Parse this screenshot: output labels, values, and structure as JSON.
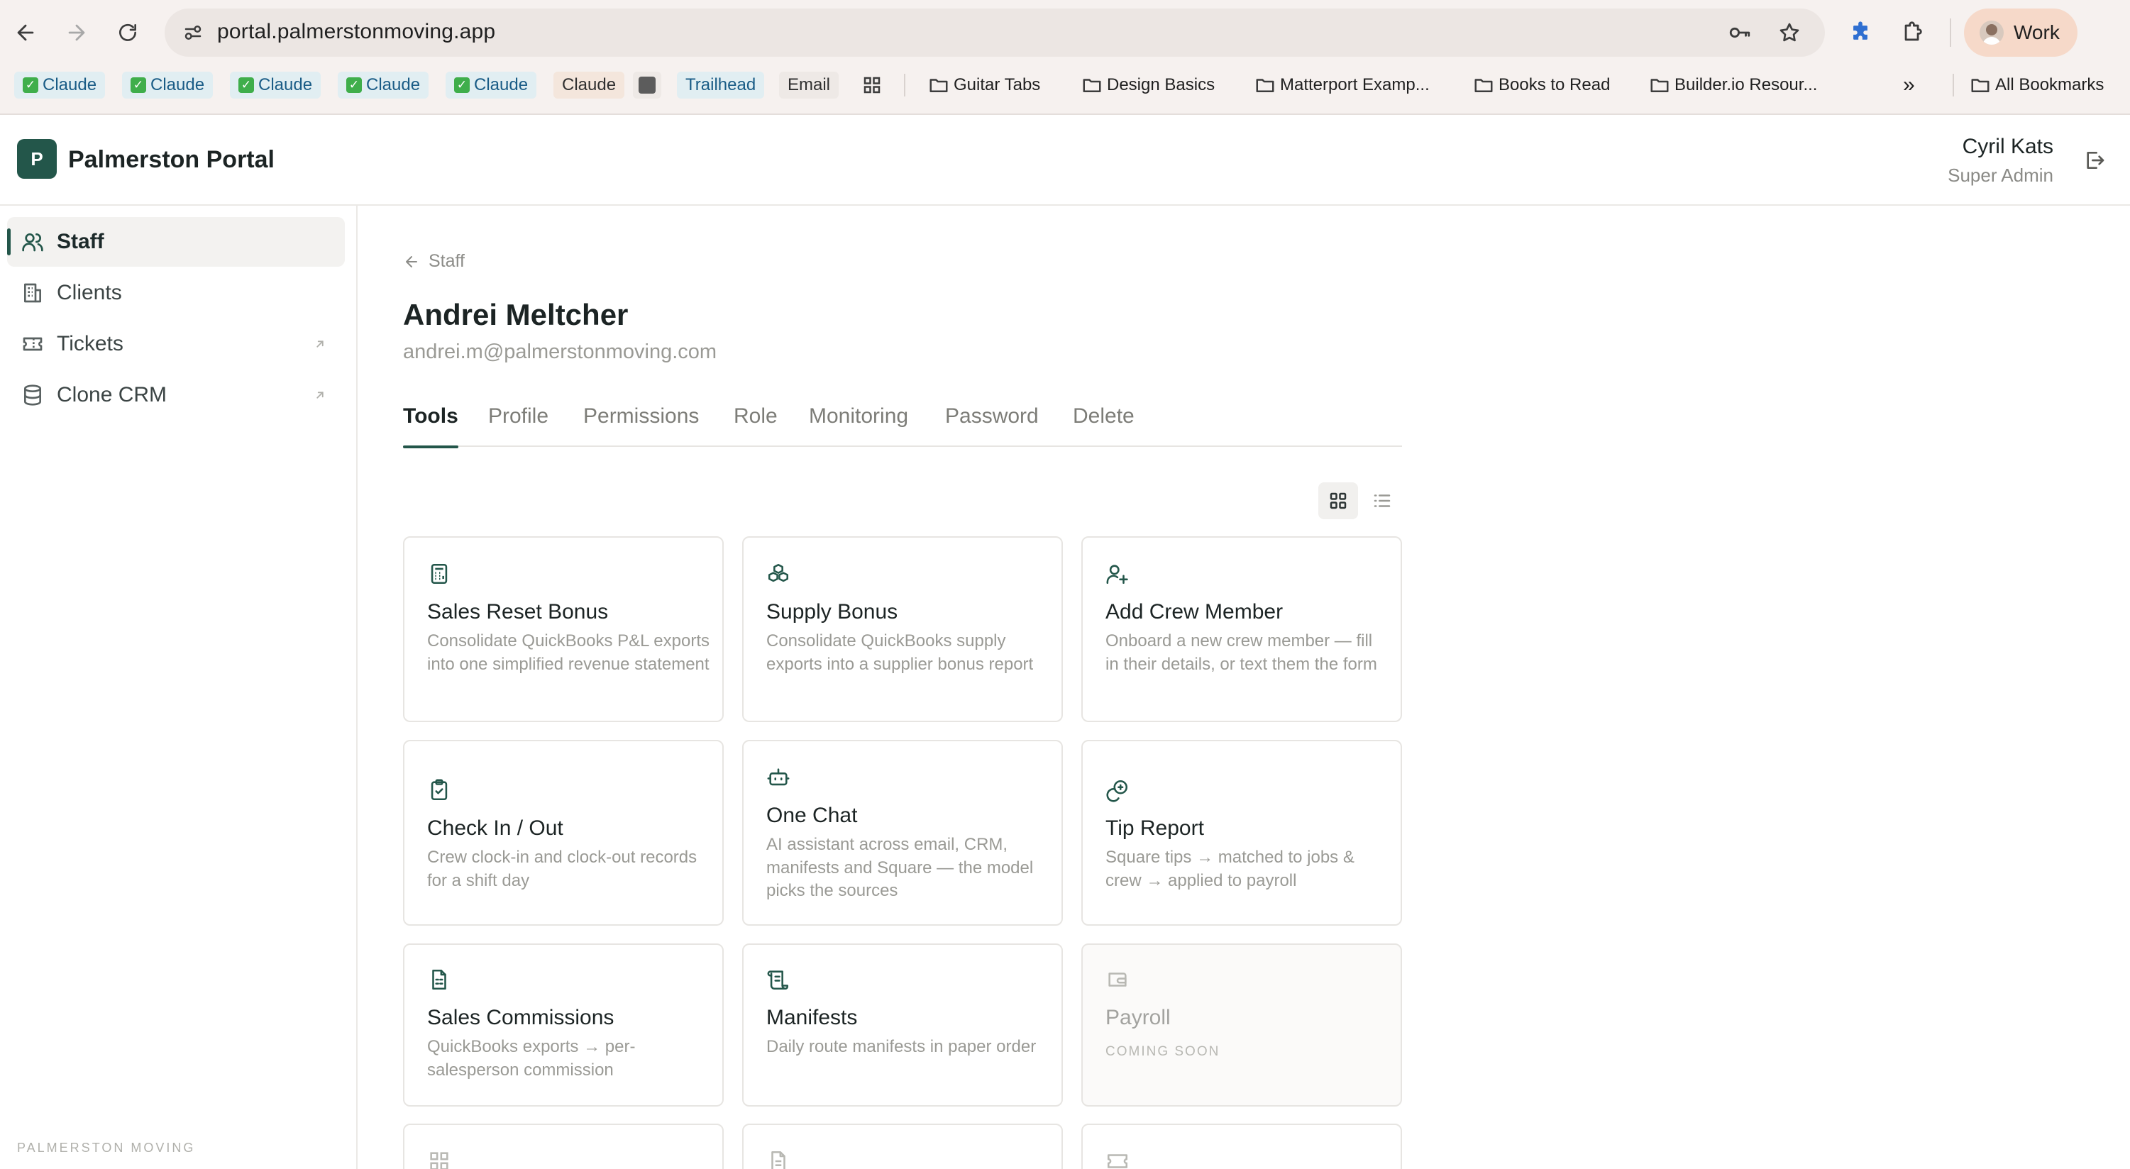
{
  "browser": {
    "url": "portal.palmerstonmoving.app",
    "profile_label": "Work",
    "bookmarks": [
      {
        "label": "Claude",
        "style": "check"
      },
      {
        "label": "Claude",
        "style": "check"
      },
      {
        "label": "Claude",
        "style": "check"
      },
      {
        "label": "Claude",
        "style": "check"
      },
      {
        "label": "Claude",
        "style": "check"
      },
      {
        "label": "Claude",
        "style": "plain"
      },
      {
        "label": "",
        "style": "square"
      },
      {
        "label": "Trailhead",
        "style": "chip"
      },
      {
        "label": "Email",
        "style": "plain"
      },
      {
        "label": "",
        "style": "apps"
      },
      {
        "label": "Guitar Tabs",
        "style": "folder"
      },
      {
        "label": "Design Basics",
        "style": "folder"
      },
      {
        "label": "Matterport Examp...",
        "style": "folder"
      },
      {
        "label": "Books to Read",
        "style": "folder"
      },
      {
        "label": "Builder.io Resour...",
        "style": "folder"
      }
    ],
    "overflow_label": "»",
    "all_bookmarks_label": "All Bookmarks"
  },
  "app": {
    "logo_letter": "P",
    "brand": "Palmerston Portal",
    "user_name": "Cyril Kats",
    "user_role": "Super Admin",
    "accent_color": "#23564a"
  },
  "sidebar": {
    "items": [
      {
        "label": "Staff",
        "icon": "users-icon",
        "active": true,
        "external": false
      },
      {
        "label": "Clients",
        "icon": "building-icon",
        "active": false,
        "external": false
      },
      {
        "label": "Tickets",
        "icon": "ticket-icon",
        "active": false,
        "external": true
      },
      {
        "label": "Clone CRM",
        "icon": "database-icon",
        "active": false,
        "external": true
      }
    ],
    "footer": "PALMERSTON MOVING"
  },
  "page": {
    "back_label": "Staff",
    "name": "Andrei Meltcher",
    "email": "andrei.m@palmerstonmoving.com",
    "tabs": [
      "Tools",
      "Profile",
      "Permissions",
      "Role",
      "Monitoring",
      "Password",
      "Delete"
    ],
    "active_tab": "Tools",
    "view_mode": "grid"
  },
  "tools": [
    {
      "title": "Sales Reset Bonus",
      "desc": "Consolidate QuickBooks P&L exports into one simplified revenue statement",
      "icon": "calculator-icon"
    },
    {
      "title": "Supply Bonus",
      "desc": "Consolidate QuickBooks supply exports into a supplier bonus report",
      "icon": "boxes-icon"
    },
    {
      "title": "Add Crew Member",
      "desc": "Onboard a new crew member — fill in their details, or text them the form",
      "icon": "user-plus-icon"
    },
    {
      "title": "Check In / Out",
      "desc": "Crew clock-in and clock-out records for a shift day",
      "icon": "clipboard-check-icon"
    },
    {
      "title": "One Chat",
      "desc": "AI assistant across email, CRM, manifests and Square — the model picks the sources",
      "icon": "bot-icon"
    },
    {
      "title": "Tip Report",
      "desc": "Square tips → matched to jobs & crew → applied to payroll",
      "icon": "coins-icon"
    },
    {
      "title": "Sales Commissions",
      "desc": "QuickBooks exports → per-salesperson commission",
      "icon": "file-spreadsheet-icon"
    },
    {
      "title": "Manifests",
      "desc": "Daily route manifests in paper order",
      "icon": "scroll-icon"
    },
    {
      "title": "Payroll",
      "desc": "",
      "badge": "COMING SOON",
      "icon": "wallet-icon",
      "disabled": true
    }
  ]
}
